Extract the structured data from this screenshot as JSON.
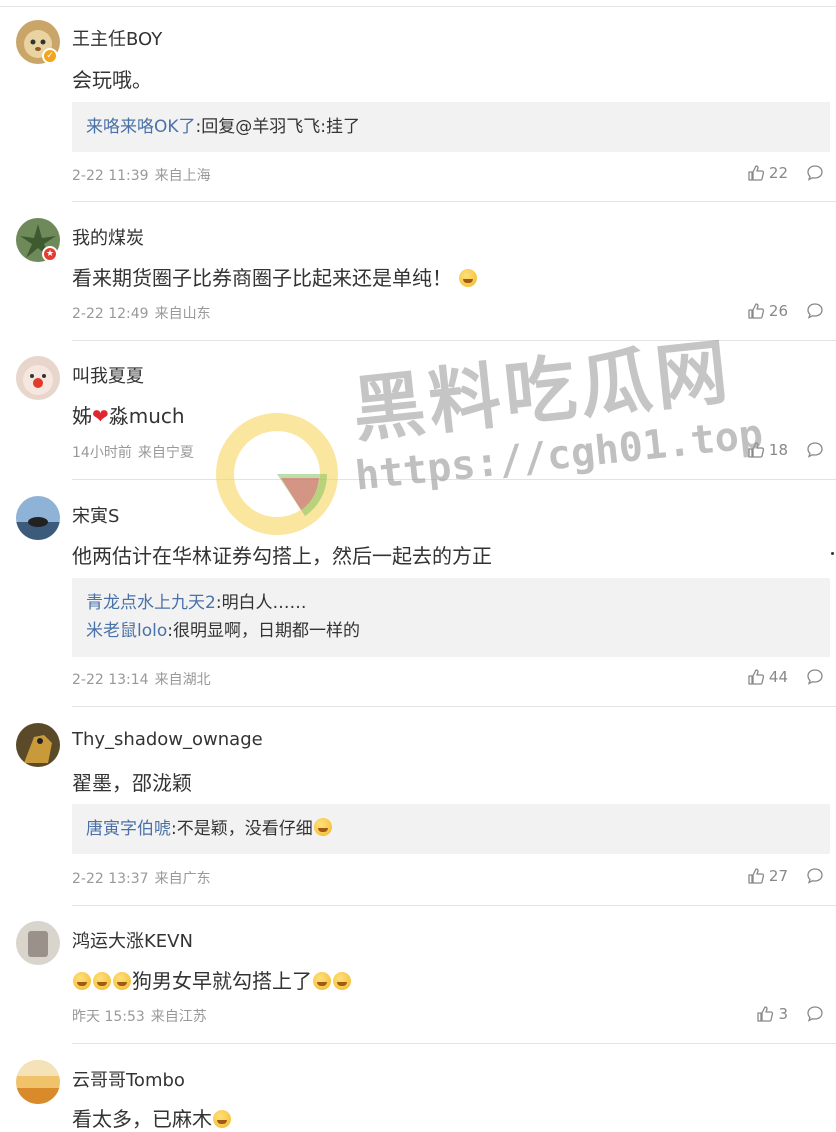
{
  "comments": [
    {
      "user": "王主任BOY",
      "text": "会玩哦。",
      "badge": "vip",
      "replies": [
        {
          "user": "来咯来咯OK了",
          "sep": ":",
          "text": "回复@羊羽飞飞:挂了"
        }
      ],
      "time": "2-22 11:39",
      "location": "来自上海",
      "likes": "22"
    },
    {
      "user": "我的煤炭",
      "text": "看来期货圈子比券商圈子比起来还是单纯！",
      "badge": "red",
      "replies": [],
      "time": "2-22 12:49",
      "location": "来自山东",
      "likes": "26"
    },
    {
      "user": "叫我夏夏",
      "text_pre": "姊",
      "text_post": "淼much",
      "replies": [],
      "time": "14小时前",
      "location": "来自宁夏",
      "likes": "18"
    },
    {
      "user": "宋寅S",
      "text": "他两估计在华林证券勾搭上，然后一起去的方正",
      "replies": [
        {
          "user": "青龙点水上九天2",
          "sep": ":",
          "text": "明白人……"
        },
        {
          "user": "米老鼠lolo",
          "sep": ":",
          "text": "很明显啊，日期都一样的"
        }
      ],
      "time": "2-22 13:14",
      "location": "来自湖北",
      "likes": "44"
    },
    {
      "user": "Thy_shadow_ownage",
      "text": "翟墨，邵泷颖",
      "replies": [
        {
          "user": "唐寅字伯唬",
          "sep": ":",
          "text": "不是颖，没看仔细"
        }
      ],
      "time": "2-22 13:37",
      "location": "来自广东",
      "likes": "27"
    },
    {
      "user": "鸿运大涨KEVN",
      "text": "狗男女早就勾搭上了",
      "replies": [],
      "time": "昨天 15:53",
      "location": "来自江苏",
      "likes": "3"
    },
    {
      "user": "云哥哥Tombo",
      "text": "看太多，已麻木",
      "replies": []
    }
  ],
  "watermark": {
    "title": "黑料吃瓜网",
    "url": "https://cgh01.top"
  },
  "colors": {
    "username_link": "#4a71a8",
    "reply_bg": "#f2f2f2",
    "meta": "#999999"
  }
}
